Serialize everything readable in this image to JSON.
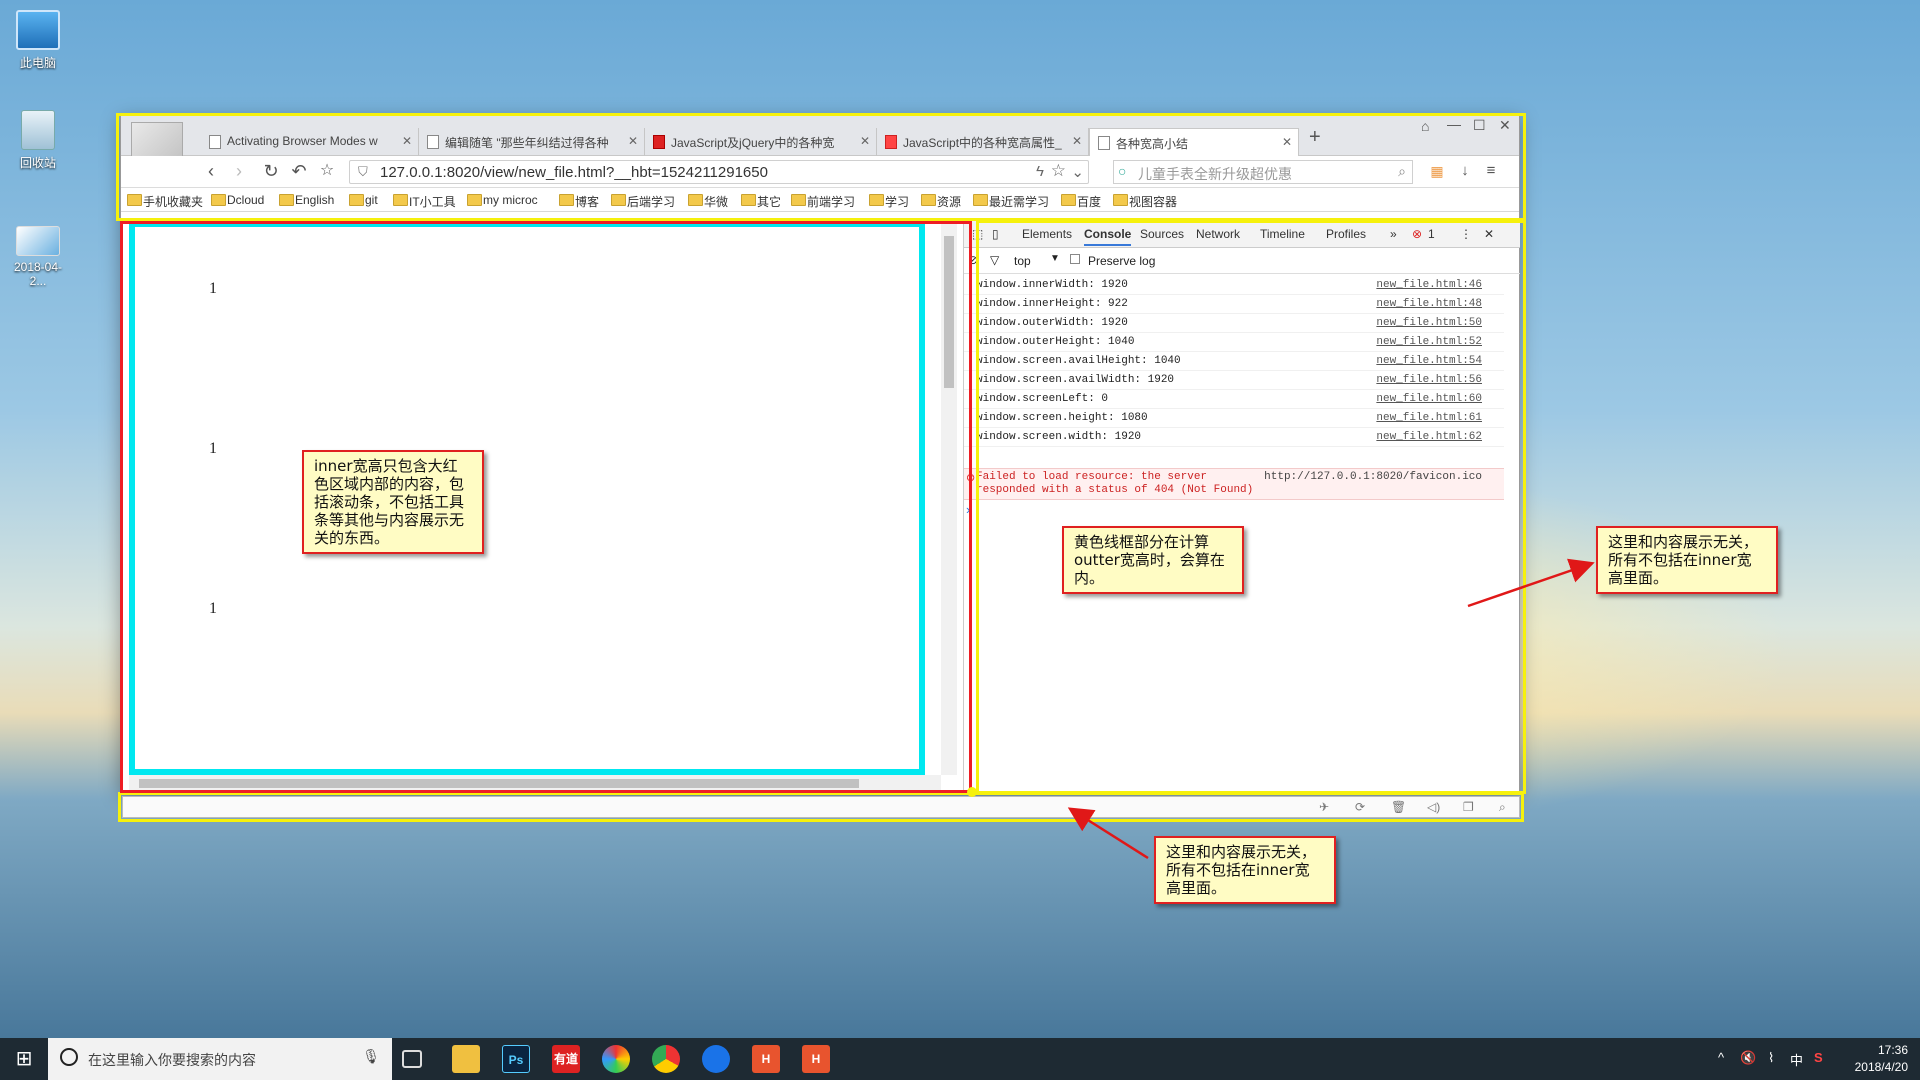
{
  "desktop": {
    "icons": [
      {
        "label": "此电脑",
        "icon": "computer-icon"
      },
      {
        "label": "回收站",
        "icon": "recycle-bin-icon"
      },
      {
        "label": "2018-04-2...",
        "icon": "image-file-icon"
      }
    ]
  },
  "browser": {
    "tabs": [
      {
        "label": "Activating Browser Modes w"
      },
      {
        "label": "编辑随笔 \"那些年纠结过得各种"
      },
      {
        "label": "JavaScript及jQuery中的各种宽"
      },
      {
        "label": "JavaScript中的各种宽高属性_"
      },
      {
        "label": "各种宽高小结"
      }
    ],
    "url": "127.0.0.1:8020/view/new_file.html?__hbt=1524211291650",
    "search_placeholder": "儿童手表全新升级超优惠",
    "bookmarks": [
      "手机收藏夹",
      "Dcloud",
      "English",
      "git",
      "IT小工具",
      "my microc",
      "博客",
      "后端学习",
      "华微",
      "其它",
      "前端学习",
      "学习",
      "资源",
      "最近需学习",
      "百度",
      "视图容器"
    ]
  },
  "page": {
    "numbers": [
      "1",
      "1",
      "1"
    ]
  },
  "devtools": {
    "tabs": [
      "Elements",
      "Console",
      "Sources",
      "Network",
      "Timeline",
      "Profiles"
    ],
    "error_count": "1",
    "filter_context": "top",
    "preserve_log_label": "Preserve log",
    "logs": [
      {
        "text": "window.innerWidth: 1920",
        "src": "new_file.html:46"
      },
      {
        "text": "window.innerHeight: 922",
        "src": "new_file.html:48"
      },
      {
        "text": "window.outerWidth: 1920",
        "src": "new_file.html:50"
      },
      {
        "text": "window.outerHeight: 1040",
        "src": "new_file.html:52"
      },
      {
        "text": "window.screen.availHeight: 1040",
        "src": "new_file.html:54"
      },
      {
        "text": "window.screen.availWidth: 1920",
        "src": "new_file.html:56"
      },
      {
        "text": "window.screenLeft: 0",
        "src": "new_file.html:60"
      },
      {
        "text": "window.screen.height: 1080",
        "src": "new_file.html:61"
      },
      {
        "text": "window.screen.width: 1920",
        "src": "new_file.html:62"
      }
    ],
    "error": {
      "line1": "Failed to load resource: the server",
      "line2": "responded with a status of 404 (Not Found)",
      "url": "http://127.0.0.1:8020/favicon.ico"
    }
  },
  "annotations": {
    "inner": "inner宽高只包含大红色区域内部的内容，包括滚动条，不包括工具条等其他与内容展示无关的东西。",
    "outer": "黄色线框部分在计算outter宽高时，会算在内。",
    "right": "这里和内容展示无关，所有不包括在inner宽高里面。",
    "bottom": "这里和内容展示无关，所有不包括在inner宽高里面。"
  },
  "taskbar": {
    "search_placeholder": "在这里输入你要搜索的内容",
    "time": "17:36",
    "date": "2018/4/20",
    "ime": "中"
  },
  "colors": {
    "frame": "#f6f10c",
    "inner_frame": "#ee1d24",
    "cyan_border": "#00e8f0",
    "note_bg": "#fffcc4"
  }
}
